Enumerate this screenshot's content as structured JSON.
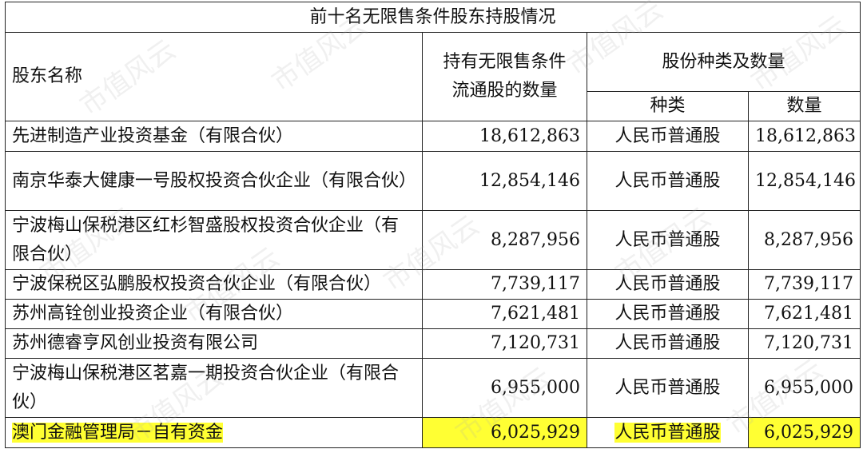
{
  "table": {
    "title": "前十名无限售条件股东持股情况",
    "headers": {
      "name": "股东名称",
      "quantity_line1": "持有无限售条件",
      "quantity_line2": "流通股的数量",
      "share_type_group": "股份种类及数量",
      "type": "种类",
      "amount": "数量"
    },
    "rows": [
      {
        "name": "先进制造产业投资基金（有限合伙）",
        "quantity": "18,612,863",
        "type": "人民币普通股",
        "amount": "18,612,863"
      },
      {
        "name": "南京华泰大健康一号股权投资合伙企业（有限合伙）",
        "quantity": "12,854,146",
        "type": "人民币普通股",
        "amount": "12,854,146"
      },
      {
        "name": "宁波梅山保税港区红杉智盛股权投资合伙企业（有限合伙）",
        "quantity": "8,287,956",
        "type": "人民币普通股",
        "amount": "8,287,956"
      },
      {
        "name": "宁波保税区弘鹏股权投资合伙企业（有限合伙）",
        "quantity": "7,739,117",
        "type": "人民币普通股",
        "amount": "7,739,117"
      },
      {
        "name": "苏州高铨创业投资企业（有限合伙）",
        "quantity": "7,621,481",
        "type": "人民币普通股",
        "amount": "7,621,481"
      },
      {
        "name": "苏州德睿亨风创业投资有限公司",
        "quantity": "7,120,731",
        "type": "人民币普通股",
        "amount": "7,120,731"
      },
      {
        "name": "宁波梅山保税港区茗嘉一期投资合伙企业（有限合伙）",
        "quantity": "6,955,000",
        "type": "人民币普通股",
        "amount": "6,955,000"
      },
      {
        "name": "澳门金融管理局－自有资金",
        "quantity": "6,025,929",
        "type": "人民币普通股",
        "amount": "6,025,929"
      }
    ]
  },
  "watermark": "市值风云",
  "colors": {
    "highlight": "#ffff33",
    "border": "#222222"
  }
}
